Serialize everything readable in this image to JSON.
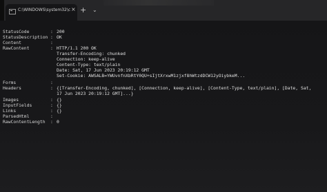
{
  "window": {
    "tab_title": "C:\\WINDOWS\\system32\\cmd.",
    "close_glyph": "×",
    "new_tab_glyph": "+",
    "dropdown_glyph": "⌄"
  },
  "response": {
    "status_code_label": "StatusCode",
    "status_code_value": "200",
    "status_description_label": "StatusDescription",
    "status_description_value": "OK",
    "content_label": "Content",
    "content_value": "",
    "raw_content_label": "RawContent",
    "raw_content_lines": [
      "HTTP/1.1 200 OK",
      "Transfer-Encoding: chunked",
      "Connection: keep-alive",
      "Content-Type: text/plain",
      "Date: Sat, 17 Jun 2023 20:19:12 GMT",
      "Set-Cookie: AWSALB=YWUvnfnXbRtY0QU+sIjtXrxwM1zjxf8hWtzdDCW12yOiybkeM..."
    ],
    "forms_label": "Forms",
    "forms_value": "",
    "headers_label": "Headers",
    "headers_lines": [
      "{[Transfer-Encoding, chunked], [Connection, keep-alive], [Content-Type, text/plain], [Date, Sat,",
      "17 Jun 2023 20:19:12 GMT]...}"
    ],
    "images_label": "Images",
    "images_value": "{}",
    "input_fields_label": "InputFields",
    "input_fields_value": "{}",
    "links_label": "Links",
    "links_value": "{}",
    "parsed_html_label": "ParsedHtml",
    "parsed_html_value": "",
    "raw_content_length_label": "RawContentLength",
    "raw_content_length_value": "0"
  },
  "colors": {
    "background": "#1a1a1c",
    "text": "#d6d6d6",
    "titlebar": "#262628"
  }
}
